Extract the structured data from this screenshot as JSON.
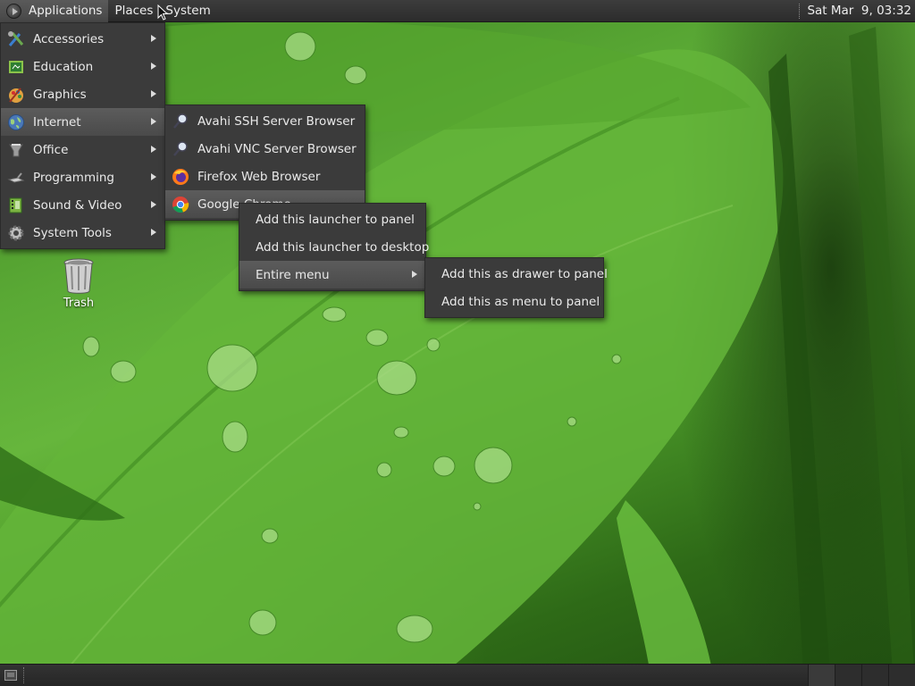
{
  "top_panel": {
    "menus": [
      "Applications",
      "Places",
      "System"
    ],
    "clock": "Sat Mar  9, 03:32"
  },
  "applications_menu": {
    "items": [
      {
        "label": "Accessories",
        "icon": "accessories-icon"
      },
      {
        "label": "Education",
        "icon": "education-icon"
      },
      {
        "label": "Graphics",
        "icon": "graphics-icon"
      },
      {
        "label": "Internet",
        "icon": "internet-icon"
      },
      {
        "label": "Office",
        "icon": "office-icon"
      },
      {
        "label": "Programming",
        "icon": "programming-icon"
      },
      {
        "label": "Sound & Video",
        "icon": "sound-video-icon"
      },
      {
        "label": "System Tools",
        "icon": "system-tools-icon"
      }
    ],
    "selected": "Internet"
  },
  "internet_menu": {
    "items": [
      {
        "label": "Avahi SSH Server Browser",
        "icon": "avahi-ssh-icon"
      },
      {
        "label": "Avahi VNC Server Browser",
        "icon": "avahi-vnc-icon"
      },
      {
        "label": "Firefox Web Browser",
        "icon": "firefox-icon"
      },
      {
        "label": "Google Chrome",
        "icon": "chrome-icon"
      }
    ],
    "selected": "Google Chrome"
  },
  "context_menu": {
    "items": [
      {
        "label": "Add this launcher to panel"
      },
      {
        "label": "Add this launcher to desktop"
      },
      {
        "label": "Entire menu",
        "submenu": true
      }
    ],
    "selected": "Entire menu"
  },
  "entire_menu_submenu": {
    "items": [
      {
        "label": "Add this as drawer to panel"
      },
      {
        "label": "Add this as menu to panel"
      }
    ]
  },
  "desktop": {
    "icons": [
      {
        "label": "Trash",
        "icon": "trash-icon"
      }
    ]
  },
  "colors": {
    "panel": "#2c2c2c",
    "menu_bg": "#3b3b3b",
    "menu_selected": "#4f4f4f",
    "wallpaper_green": "#5aa935"
  }
}
